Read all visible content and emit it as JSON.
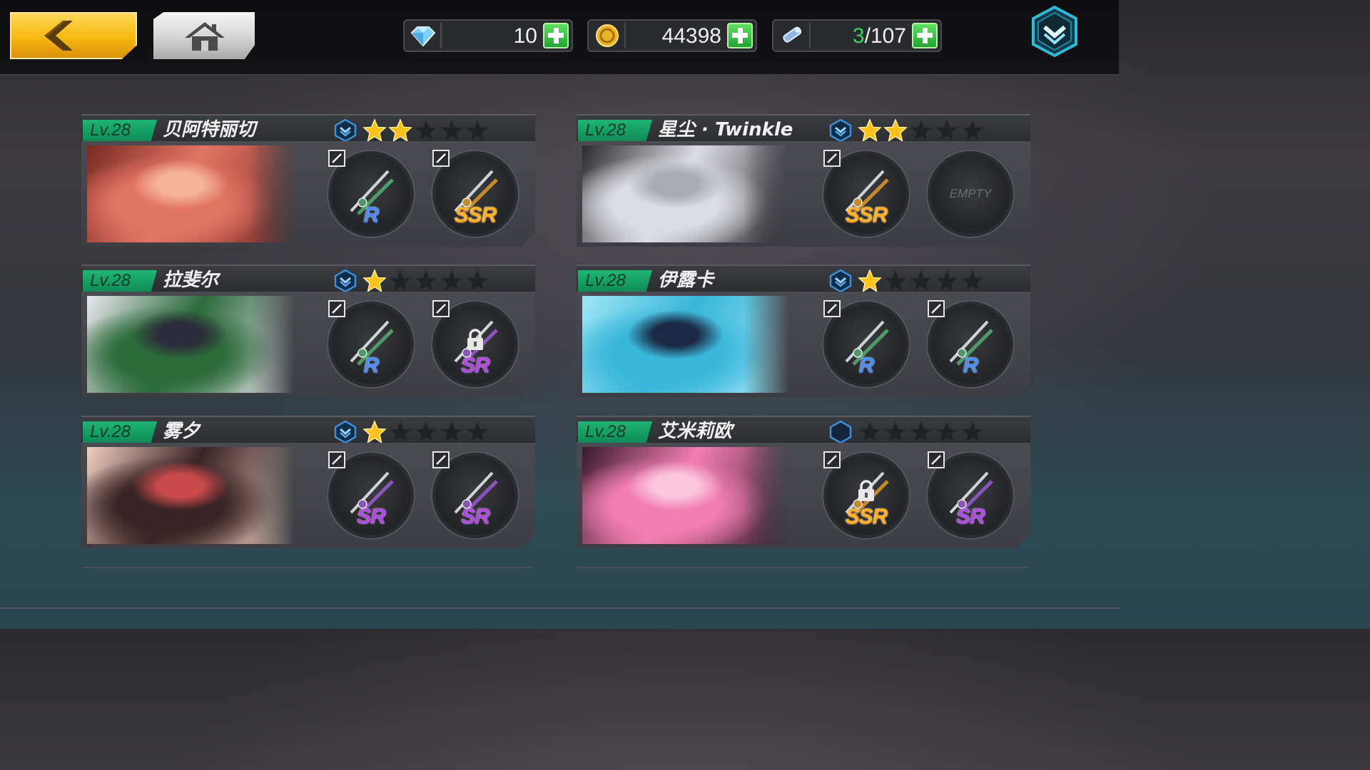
{
  "resources": {
    "diamonds": "10",
    "gold": "44398",
    "stamina_current": "3",
    "stamina_max": "/107"
  },
  "accent_colors": {
    "level_badge": "#1fb477",
    "plus": "#1fa533",
    "back": "#f6b812",
    "rank": "#3a8fd9"
  },
  "cards": [
    {
      "level": "Lv.28",
      "name": "贝阿特丽切",
      "stars": 2,
      "rank_filled": true,
      "portrait": [
        "#e37564",
        "#f5b39a",
        "#7a2b22"
      ],
      "slots": [
        {
          "rarity": "R",
          "weapon": "rapier-icon",
          "locked": false,
          "empty": false
        },
        {
          "rarity": "SSR",
          "weapon": "lance-icon",
          "locked": false,
          "empty": false
        }
      ]
    },
    {
      "level": "Lv.28",
      "name": "星尘 · Twinkle",
      "stars": 2,
      "rank_filled": true,
      "portrait": [
        "#dcdde2",
        "#a9abb3",
        "#2a2a2e"
      ],
      "slots": [
        {
          "rarity": "SSR",
          "weapon": "star-emblem-icon",
          "locked": false,
          "empty": false
        },
        {
          "rarity": "",
          "weapon": "",
          "locked": false,
          "empty": true,
          "empty_text": "EMPTY"
        }
      ]
    },
    {
      "level": "Lv.28",
      "name": "拉斐尔",
      "stars": 1,
      "rank_filled": true,
      "portrait": [
        "#2c6b3a",
        "#2b2e3a",
        "#e8e8ee"
      ],
      "slots": [
        {
          "rarity": "R",
          "weapon": "flower-sword-icon",
          "locked": false,
          "empty": false
        },
        {
          "rarity": "SR",
          "weapon": "thorn-ring-icon",
          "locked": true,
          "empty": false
        }
      ]
    },
    {
      "level": "Lv.28",
      "name": "伊露卡",
      "stars": 1,
      "rank_filled": true,
      "portrait": [
        "#39b6d9",
        "#1b2a44",
        "#9ee6f5"
      ],
      "slots": [
        {
          "rarity": "R",
          "weapon": "twin-daggers-icon",
          "locked": false,
          "empty": false
        },
        {
          "rarity": "R",
          "weapon": "crystal-sword-icon",
          "locked": false,
          "empty": false
        }
      ]
    },
    {
      "level": "Lv.28",
      "name": "雾夕",
      "stars": 1,
      "rank_filled": true,
      "portrait": [
        "#3a2326",
        "#c94a4a",
        "#f0d0c0"
      ],
      "slots": [
        {
          "rarity": "SR",
          "weapon": "fan-icon",
          "locked": false,
          "empty": false
        },
        {
          "rarity": "SR",
          "weapon": "chain-spear-icon",
          "locked": false,
          "empty": false
        }
      ]
    },
    {
      "level": "Lv.28",
      "name": "艾米莉欧",
      "stars": 0,
      "rank_filled": false,
      "portrait": [
        "#f27fb0",
        "#fbc5dc",
        "#3a1a2a"
      ],
      "slots": [
        {
          "rarity": "SSR",
          "weapon": "skull-axe-icon",
          "locked": true,
          "empty": false
        },
        {
          "rarity": "SR",
          "weapon": "rifle-icon",
          "locked": false,
          "empty": false
        }
      ]
    }
  ]
}
